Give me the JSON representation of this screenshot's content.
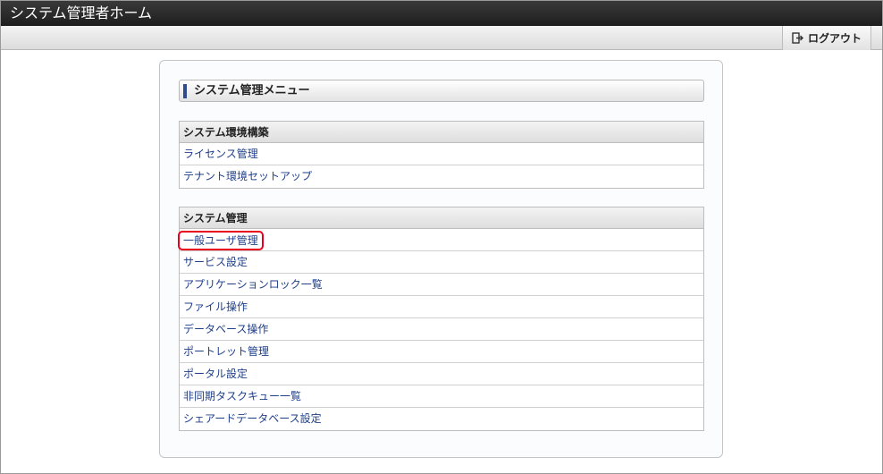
{
  "window": {
    "title": "システム管理者ホーム"
  },
  "toolbar": {
    "logout_label": "ログアウト",
    "logout_icon": "logout-icon"
  },
  "menu": {
    "title": "システム管理メニュー",
    "accent_color": "#2d4c8e",
    "groups": [
      {
        "title": "システム環境構築",
        "items": [
          {
            "label": "ライセンス管理"
          },
          {
            "label": "テナント環境セットアップ"
          }
        ]
      },
      {
        "title": "システム管理",
        "items": [
          {
            "label": "一般ユーザ管理",
            "highlighted": true
          },
          {
            "label": "サービス設定"
          },
          {
            "label": "アプリケーションロック一覧"
          },
          {
            "label": "ファイル操作"
          },
          {
            "label": "データベース操作"
          },
          {
            "label": "ポートレット管理"
          },
          {
            "label": "ポータル設定"
          },
          {
            "label": "非同期タスクキュー一覧"
          },
          {
            "label": "シェアードデータベース設定"
          }
        ]
      }
    ]
  },
  "colors": {
    "link": "#1f3f8a",
    "highlight_border": "#e8001c",
    "titlebar": "#1e1e1e"
  }
}
